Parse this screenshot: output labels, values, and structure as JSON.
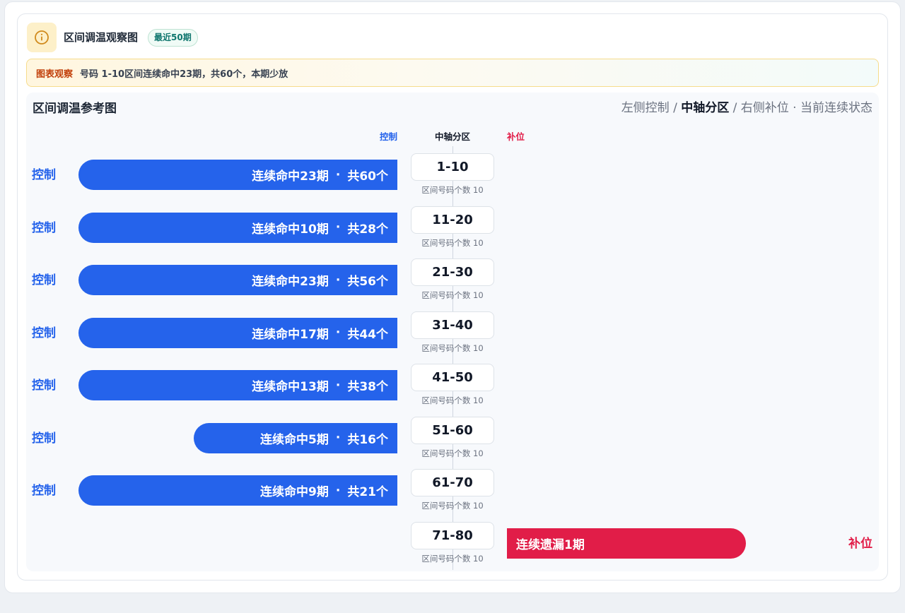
{
  "header": {
    "title": "区间调温观察图",
    "badge": "最近50期",
    "icon": "info-icon"
  },
  "observation": {
    "tag": "图表观察",
    "text": "号码 1-10区间连续命中23期，共60个，本期少放"
  },
  "panel": {
    "title": "区间调温参考图",
    "legend": {
      "left": "左侧控制",
      "sep1": " / ",
      "mid": "中轴分区",
      "sep2": " / ",
      "right": "右侧补位",
      "dot": " · ",
      "tail": "当前连续状态"
    },
    "col_headers": {
      "left": "控制",
      "mid": "中轴分区",
      "right": "补位"
    },
    "count_label": "区间号码个数 10"
  },
  "colors": {
    "control": "#2563eb",
    "fill": "#e11d48",
    "accent": "#f59e0b"
  },
  "chart_data": {
    "type": "bar",
    "title": "区间调温参考图",
    "categories": [
      "1-10",
      "11-20",
      "21-30",
      "31-40",
      "41-50",
      "51-60",
      "61-70",
      "71-80"
    ],
    "series": [
      {
        "name": "控制",
        "side": "left",
        "streak": [
          23,
          10,
          23,
          17,
          13,
          5,
          9,
          null
        ],
        "total": [
          60,
          28,
          56,
          44,
          38,
          16,
          21,
          null
        ]
      },
      {
        "name": "补位",
        "side": "right",
        "streak": [
          null,
          null,
          null,
          null,
          null,
          null,
          null,
          1
        ]
      }
    ],
    "rows": [
      {
        "side_label": "控制",
        "range": "1-10",
        "bar_text": "连续命中23期",
        "total_text": "共60个"
      },
      {
        "side_label": "控制",
        "range": "11-20",
        "bar_text": "连续命中10期",
        "total_text": "共28个"
      },
      {
        "side_label": "控制",
        "range": "21-30",
        "bar_text": "连续命中23期",
        "total_text": "共56个"
      },
      {
        "side_label": "控制",
        "range": "31-40",
        "bar_text": "连续命中17期",
        "total_text": "共44个"
      },
      {
        "side_label": "控制",
        "range": "41-50",
        "bar_text": "连续命中13期",
        "total_text": "共38个"
      },
      {
        "side_label": "控制",
        "range": "51-60",
        "bar_text": "连续命中5期",
        "total_text": "共16个"
      },
      {
        "side_label": "控制",
        "range": "61-70",
        "bar_text": "连续命中9期",
        "total_text": "共21个"
      },
      {
        "side_label": "补位",
        "range": "71-80",
        "bar_text": "连续遗漏1期",
        "total_text": ""
      }
    ]
  }
}
